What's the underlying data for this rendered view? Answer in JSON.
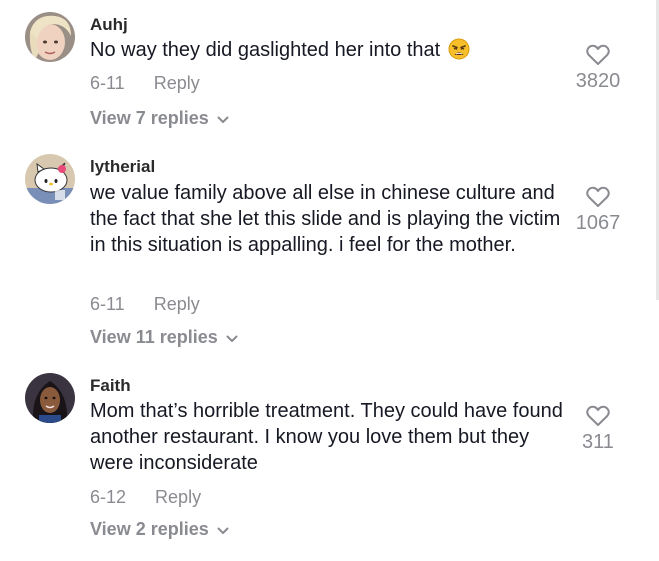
{
  "comments": [
    {
      "username": "Auhj",
      "text": "No way they did gaslighted her into that",
      "emoji_icon": "weary-face-emoji",
      "date": "6-11",
      "reply_label": "Reply",
      "likes": "3820",
      "view_replies": "View 7 replies",
      "avatar_icon": "avatar-blonde-person"
    },
    {
      "username": "lytherial",
      "text": "we value family above all else in chinese culture and the fact that she let this slide and is playing the victim in this situation is appalling. i feel for the mother.",
      "date": "6-11",
      "reply_label": "Reply",
      "likes": "1067",
      "view_replies": "View 11 replies",
      "avatar_icon": "avatar-hello-kitty"
    },
    {
      "username": "Faith",
      "text": "Mom that’s horrible treatment. They could have found another restaurant. I know you love them but they were inconsiderate",
      "date": "6-12",
      "reply_label": "Reply",
      "likes": "311",
      "view_replies": "View 2 replies",
      "avatar_icon": "avatar-dark-hair-person"
    }
  ],
  "icons": {
    "like": "heart-outline-icon",
    "expand": "chevron-down-icon"
  },
  "colors": {
    "text": "#161823",
    "secondary": "#8a8b91",
    "background": "#ffffff"
  }
}
